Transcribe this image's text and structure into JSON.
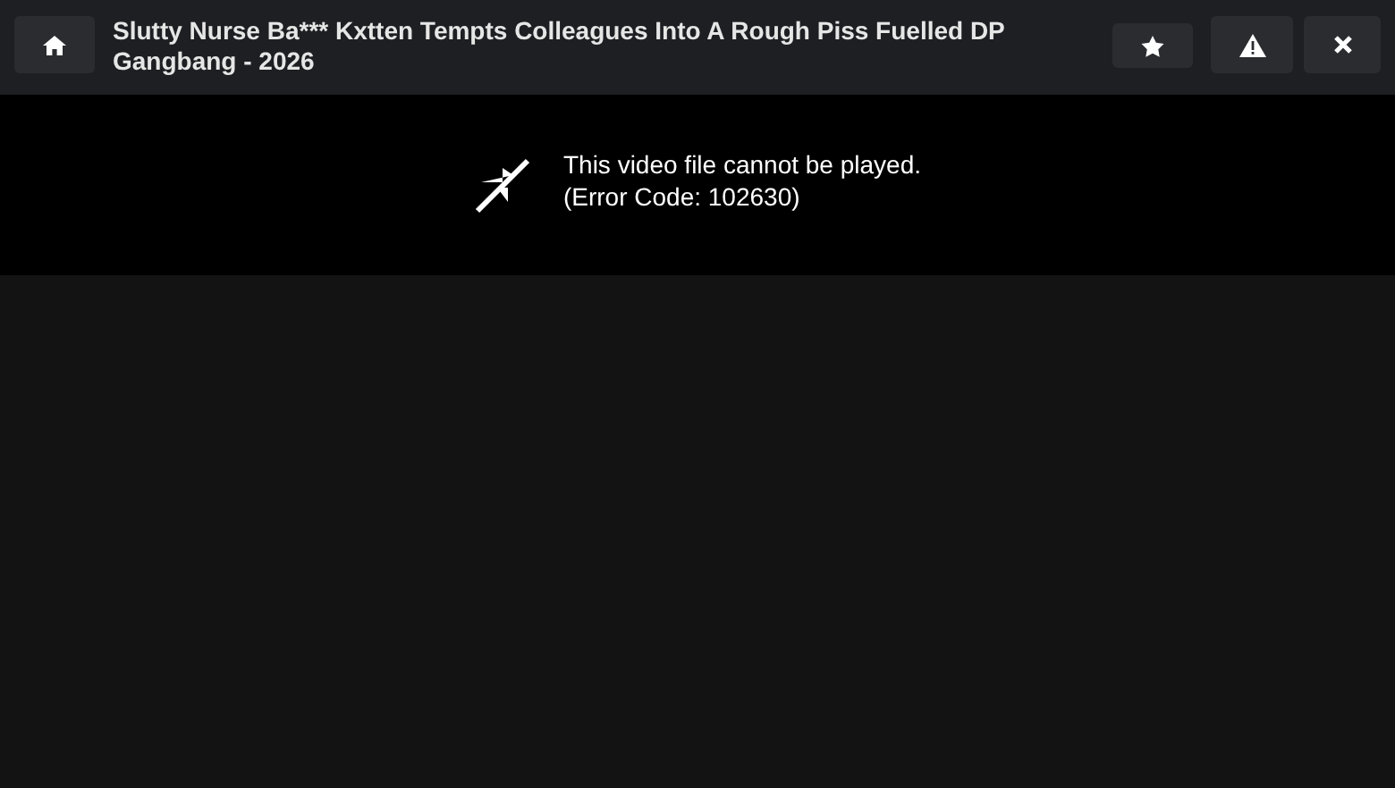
{
  "header": {
    "title": "Slutty Nurse Ba*** Kxtten Tempts Colleagues Into A Rough Piss Fuelled DP Gangbang - 2026"
  },
  "player": {
    "error_lines": [
      "This video file cannot be played.",
      "(Error Code: 102630)"
    ]
  }
}
